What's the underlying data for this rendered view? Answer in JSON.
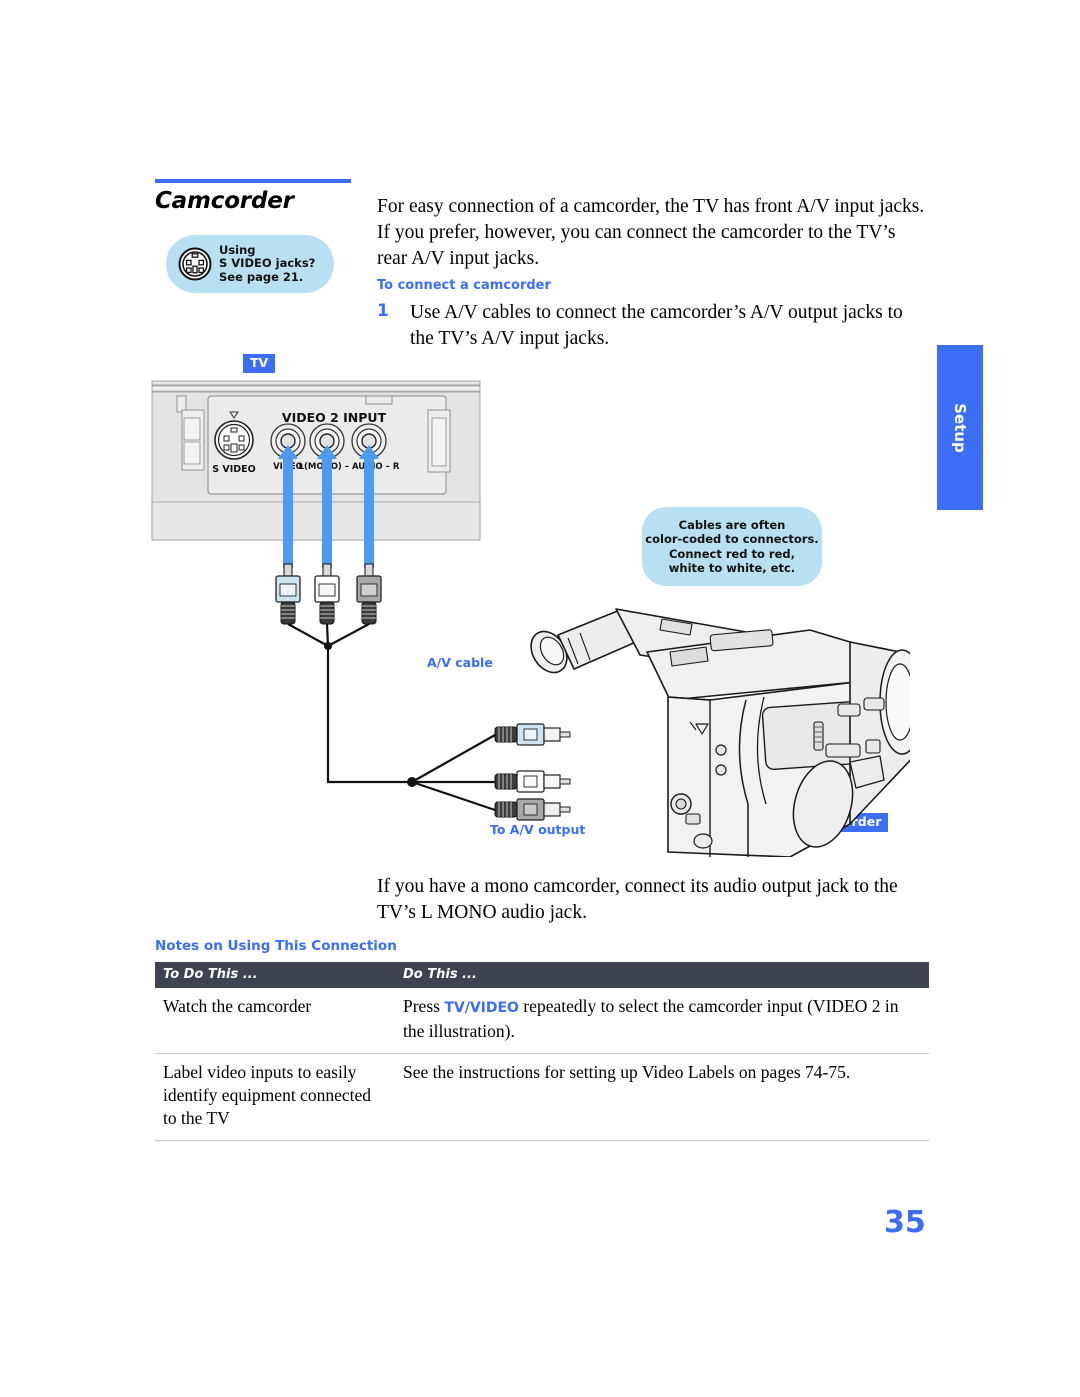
{
  "heading": {
    "title": "Camcorder",
    "rule_color": "#3b6ef5"
  },
  "svideo_tip": {
    "icon": "s-video-connector-icon",
    "line1": "Using",
    "line2": "S VIDEO jacks?",
    "line3": "See page 21.",
    "background": "#b9e0f2"
  },
  "intro": {
    "paragraph": "For easy connection of a camcorder, the TV has front A/V input jacks. If you prefer, however, you can connect the camcorder to the TV’s rear A/V input jacks."
  },
  "procedure": {
    "subhead": "To connect a camcorder",
    "step_number": "1",
    "step_text": "Use A/V cables to connect the camcorder’s A/V output jacks to the TV’s A/V input jacks."
  },
  "side_tab": {
    "label": "Setup",
    "color": "#3b6ef5"
  },
  "illustration": {
    "tv_badge": "TV",
    "camcorder_badge": "Camcorder",
    "panel": {
      "group_label": "VIDEO 2 INPUT",
      "svideo_label": "S VIDEO",
      "jack_video": "VIDEO",
      "jack_audio": "L(MONO) – AUDIO – R"
    },
    "labels": {
      "av_cable": "A/V cable",
      "to_av_output": "To A/V output"
    },
    "cable_tip": {
      "line1": "Cables are often",
      "line2": "color-coded to connectors.",
      "line3": "Connect red to red,",
      "line4": "white to white, etc.",
      "background": "#b9e0f2"
    },
    "plug_colors": [
      "#cfe4f2",
      "#ffffff",
      "#a8a8a8"
    ]
  },
  "mono_note": {
    "paragraph": "If you have a mono camcorder, connect its audio output jack to the TV’s L MONO audio jack."
  },
  "notes": {
    "heading": "Notes on Using This Connection",
    "columns": [
      "To Do This ...",
      "Do This ..."
    ],
    "rows": [
      {
        "to_do": "Watch the camcorder",
        "do_pre": "Press ",
        "do_hl": "TV/VIDEO",
        "do_post": " repeatedly to select the camcorder input (VIDEO 2 in the illustration)."
      },
      {
        "to_do": "Label video inputs to easily identify equipment connected to the TV",
        "do_pre": "See the instructions for setting up Video Labels on pages 74-75.",
        "do_hl": "",
        "do_post": ""
      }
    ]
  },
  "footer": {
    "page_number": "35"
  }
}
